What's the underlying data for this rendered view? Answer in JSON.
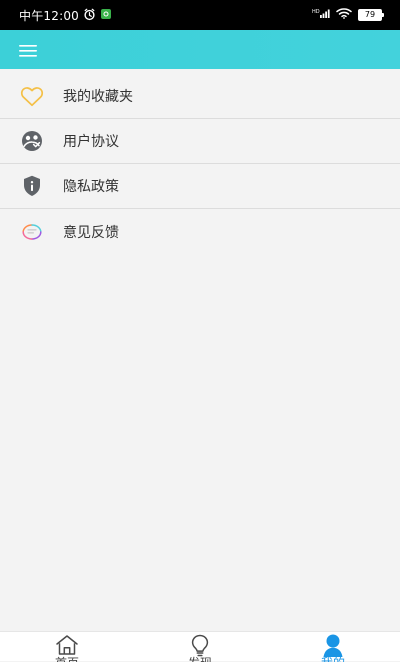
{
  "status_bar": {
    "time": "中午12:00",
    "battery": "79"
  },
  "menu_items": [
    {
      "label": "我的收藏夹",
      "icon": "heart-icon"
    },
    {
      "label": "用户协议",
      "icon": "agreement-icon"
    },
    {
      "label": "隐私政策",
      "icon": "privacy-shield-icon"
    },
    {
      "label": "意见反馈",
      "icon": "feedback-icon"
    }
  ],
  "bottom_nav": [
    {
      "label": "首页",
      "icon": "home-icon",
      "active": false
    },
    {
      "label": "发现",
      "icon": "lightbulb-icon",
      "active": false
    },
    {
      "label": "我的",
      "icon": "user-icon",
      "active": true
    }
  ],
  "colors": {
    "app_bar": "#3ccfd8",
    "active_tab": "#1a95e5",
    "heart": "#f4c047"
  }
}
